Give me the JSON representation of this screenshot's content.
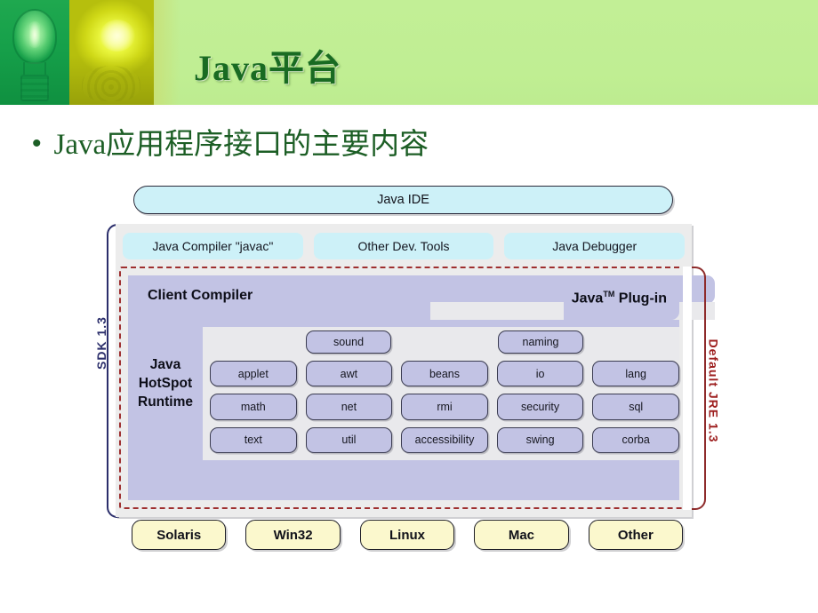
{
  "slide": {
    "title": "Java平台",
    "bullet_marker": "•",
    "bullet_text": "Java应用程序接口的主要内容"
  },
  "diagram": {
    "ide": {
      "label": "Java IDE"
    },
    "dev_tools": [
      {
        "label": "Java Compiler \"javac\""
      },
      {
        "label": "Other Dev. Tools"
      },
      {
        "label": "Java Debugger"
      }
    ],
    "band": {
      "client_compiler": "Client Compiler",
      "plugin_prefix": "Java",
      "plugin_tm": "TM",
      "plugin_suffix": "Plug-in"
    },
    "runtime_label": [
      "Java",
      "HotSpot",
      "Runtime"
    ],
    "top_packages": [
      {
        "label": "sound"
      },
      {
        "label": "naming"
      }
    ],
    "packages": [
      "applet",
      "awt",
      "beans",
      "io",
      "lang",
      "math",
      "net",
      "rmi",
      "security",
      "sql",
      "text",
      "util",
      "accessibility",
      "swing",
      "corba"
    ],
    "platforms": [
      {
        "label": "Solaris"
      },
      {
        "label": "Win32"
      },
      {
        "label": "Linux"
      },
      {
        "label": "Mac"
      },
      {
        "label": "Other"
      }
    ],
    "brackets": {
      "sdk": "SDK 1.3",
      "jre": "Default JRE 1.3"
    },
    "colors": {
      "header_green": "#c2ef96",
      "title_green": "#196b22",
      "ide_blue": "#cdf1f8",
      "package_purple": "#c2c3e4",
      "panel_grey": "#e9e9ec",
      "platform_yellow": "#fbf8cd",
      "sdk_navy": "#2b2e6b",
      "jre_red": "#9e2020"
    }
  }
}
